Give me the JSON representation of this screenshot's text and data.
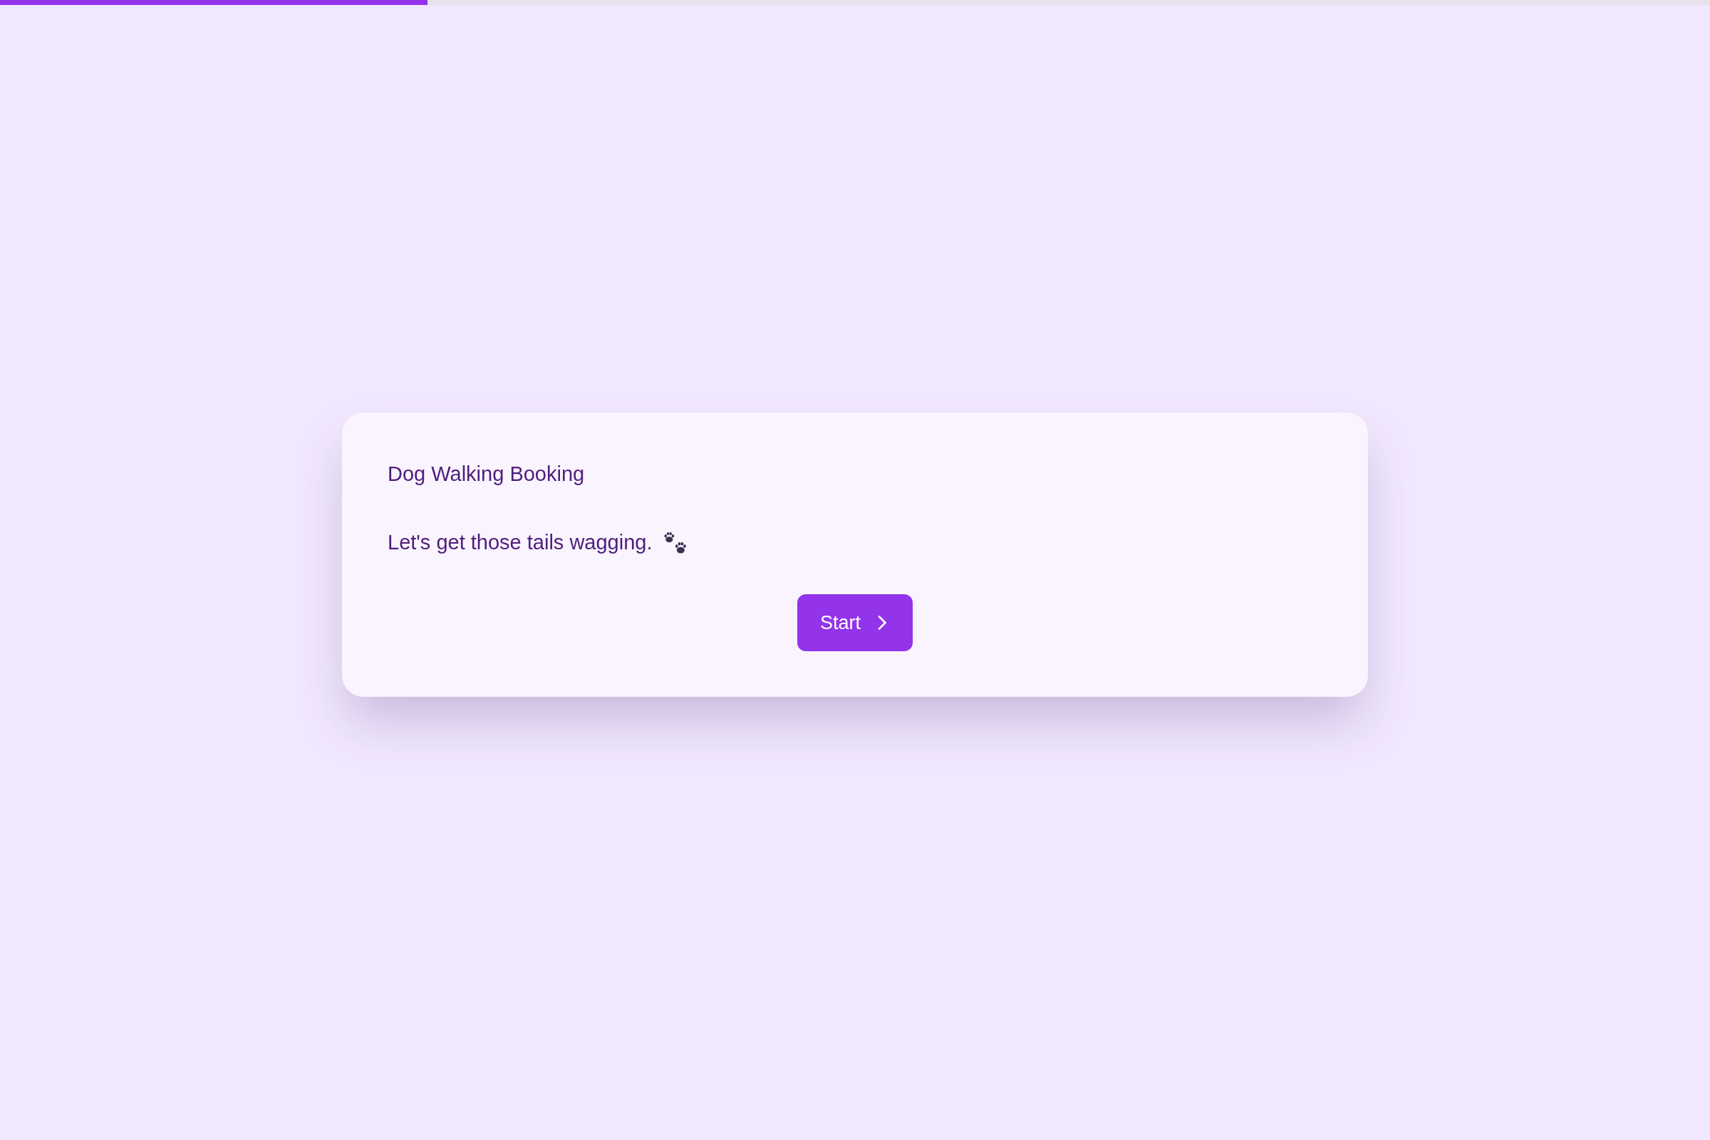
{
  "progress": {
    "level": 0.25
  },
  "card": {
    "title": "Dog Walking Booking",
    "subtitle": "Let's get those tails wagging.",
    "button": {
      "label": "Start"
    }
  }
}
